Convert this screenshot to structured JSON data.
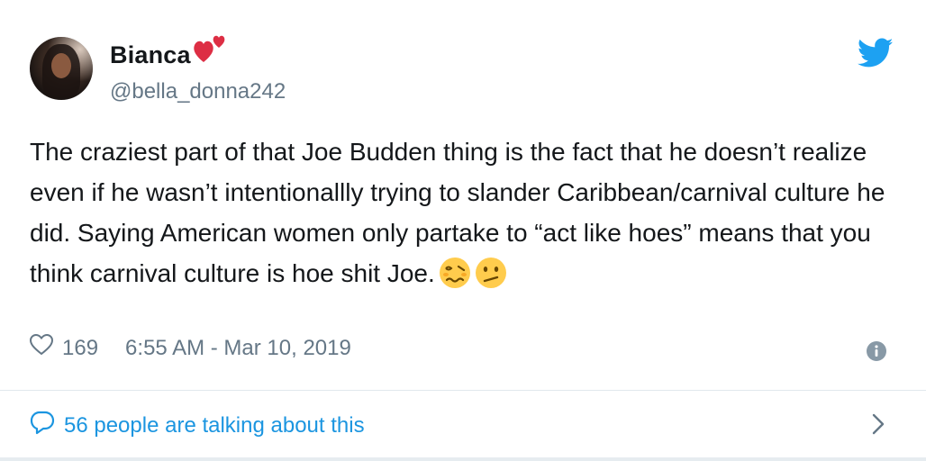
{
  "tweet": {
    "display_name": "Bianca",
    "handle": "@bella_donna242",
    "text": "The craziest part of that Joe Budden thing is the fact that he doesn’t realize even if he wasn’t intentionallly trying to slander Caribbean/carnival culture he did. Saying American women only partake to “act like hoes” means that you think carnival culture is hoe shit Joe.",
    "name_emoji": "two-hearts",
    "trailing_emojis": [
      "woozy-face",
      "confused-face"
    ],
    "like_count": "169",
    "timestamp": "6:55 AM - Mar 10, 2019",
    "talking_about": "56 people are talking about this"
  },
  "colors": {
    "accent": "#1b95e0",
    "twitter_blue": "#1da1f2",
    "muted_text": "#657786",
    "heart_red": "#e0245e"
  },
  "icons": [
    "twitter-bird-icon",
    "heart-outline-icon",
    "info-icon",
    "comment-bubble-icon",
    "chevron-right-icon"
  ]
}
